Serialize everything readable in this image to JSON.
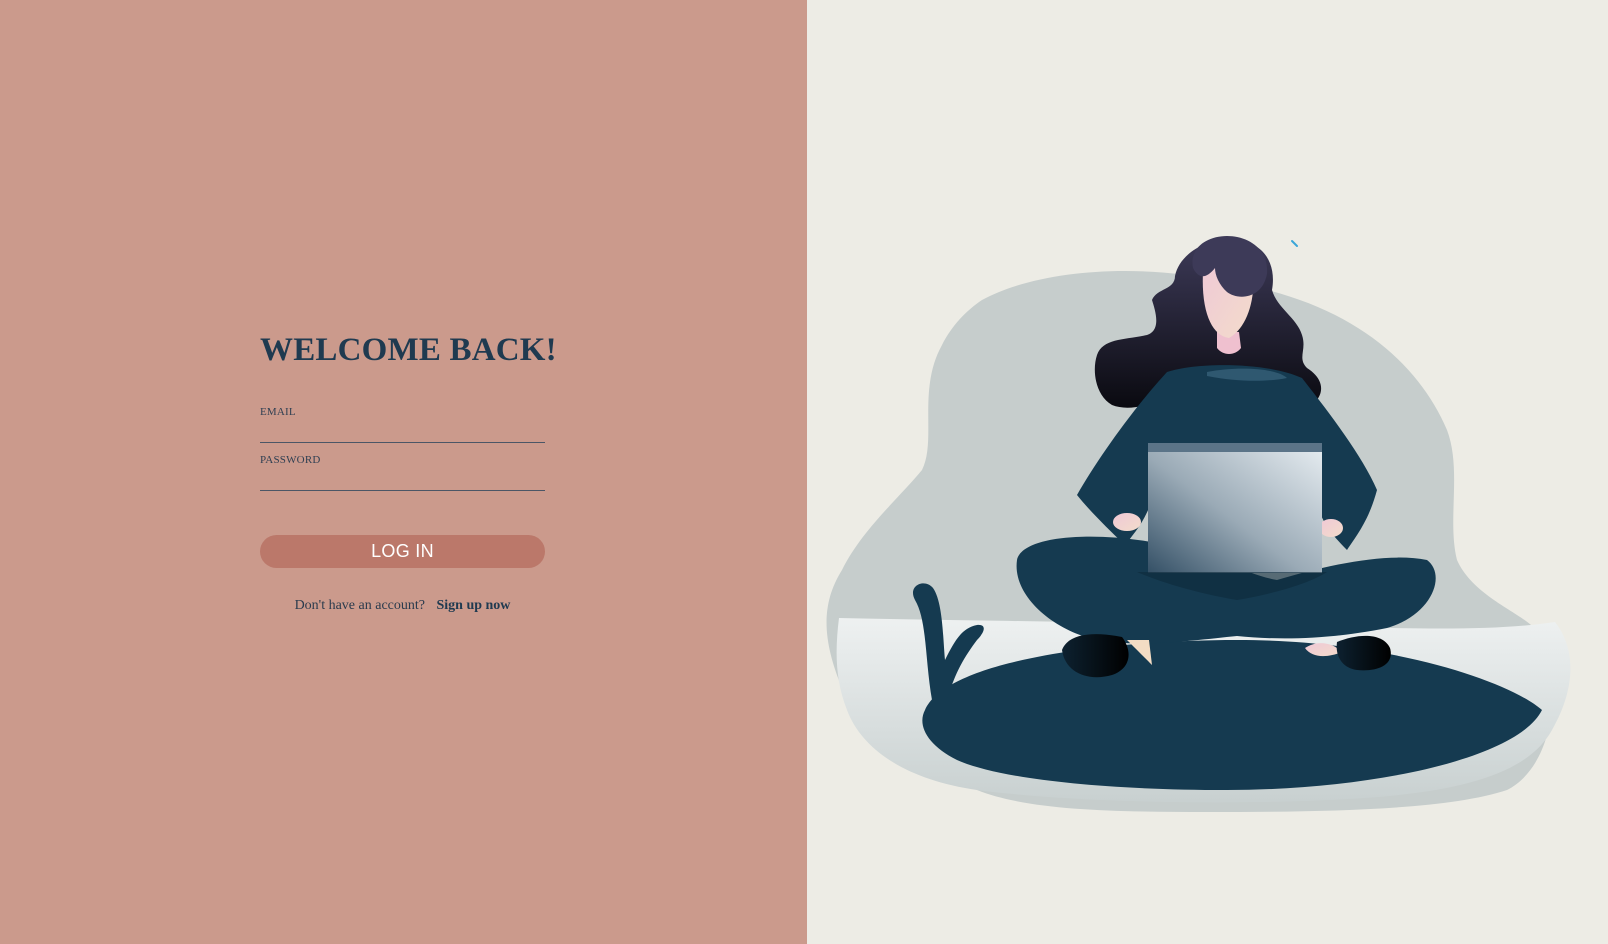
{
  "login": {
    "title": "WELCOME BACK!",
    "email_label": "EMAIL",
    "email_value": "",
    "password_label": "PASSWORD",
    "password_value": "",
    "login_button_label": "LOG IN",
    "signup_prompt": "Don't have an account?",
    "signup_link_label": "Sign up now"
  },
  "illustration": {
    "name": "woman-with-laptop-illustration"
  },
  "colors": {
    "left_panel_bg": "#cb9a8c",
    "right_panel_bg": "#edece5",
    "title": "#1f3a50",
    "button_bg": "#bb786a",
    "button_text": "#ffffff",
    "figure_dark": "#153a50",
    "blob": "#c6cdcc"
  }
}
